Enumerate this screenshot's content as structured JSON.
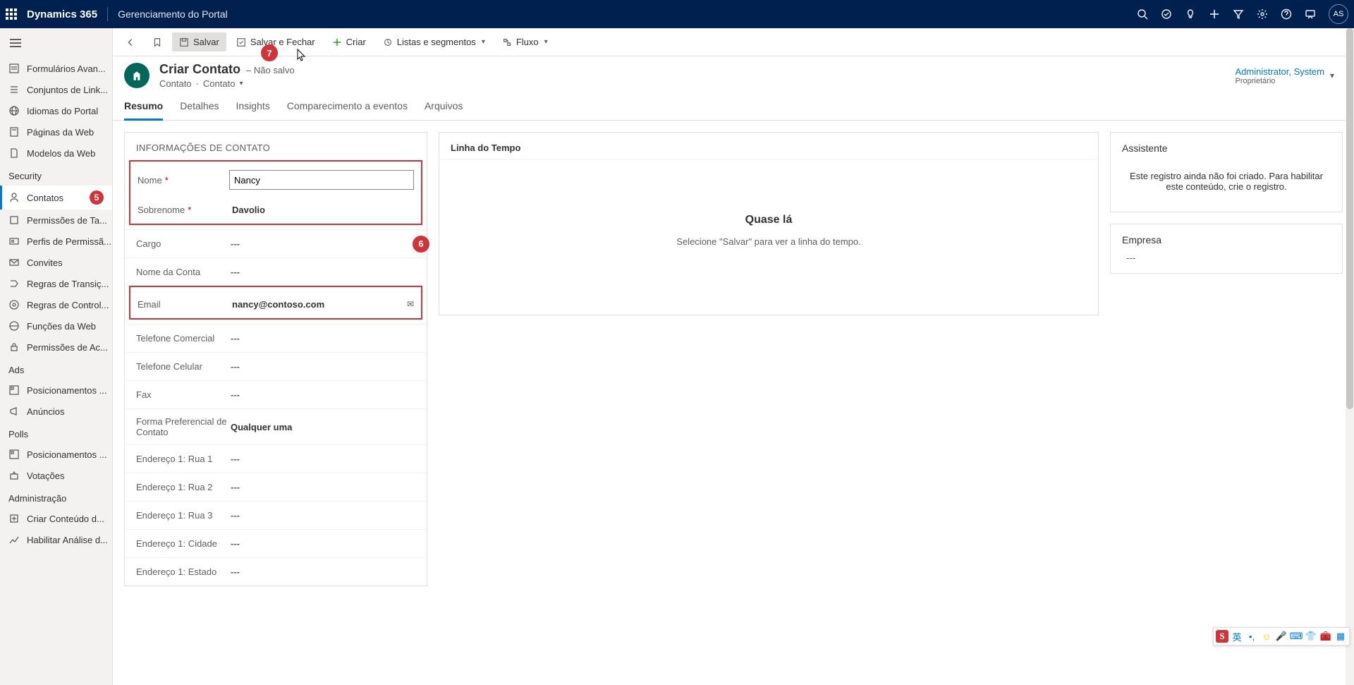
{
  "topbar": {
    "appName": "Dynamics 365",
    "subName": "Gerenciamento do Portal",
    "avatar": "AS"
  },
  "nav": {
    "topItems": [
      {
        "label": "Formulários Avan..."
      },
      {
        "label": "Conjuntos de Link..."
      },
      {
        "label": "Idiomas do Portal"
      },
      {
        "label": "Páginas da Web"
      },
      {
        "label": "Modelos da Web"
      }
    ],
    "groups": [
      {
        "title": "Security",
        "items": [
          {
            "label": "Contatos",
            "active": true,
            "badge": "5"
          },
          {
            "label": "Permissões de Ta..."
          },
          {
            "label": "Perfis de Permissã..."
          },
          {
            "label": "Convites"
          },
          {
            "label": "Regras de Transiç..."
          },
          {
            "label": "Regras de Control..."
          },
          {
            "label": "Funções da Web"
          },
          {
            "label": "Permissões de Ac..."
          }
        ]
      },
      {
        "title": "Ads",
        "items": [
          {
            "label": "Posicionamentos ..."
          },
          {
            "label": "Anúncios"
          }
        ]
      },
      {
        "title": "Polls",
        "items": [
          {
            "label": "Posicionamentos ..."
          },
          {
            "label": "Votações"
          }
        ]
      },
      {
        "title": "Administração",
        "items": [
          {
            "label": "Criar Conteúdo d..."
          },
          {
            "label": "Habilitar Análise d..."
          }
        ]
      }
    ]
  },
  "cmd": {
    "save": "Salvar",
    "saveClose": "Salvar e Fechar",
    "create": "Criar",
    "lists": "Listas e segmentos",
    "flow": "Fluxo"
  },
  "annot": {
    "a5": "5",
    "a6": "6",
    "a7": "7"
  },
  "record": {
    "title": "Criar Contato",
    "unsaved": "– Não salvo",
    "crumb1": "Contato",
    "crumb2": "Contato",
    "ownerName": "Administrator, System",
    "ownerLabel": "Proprietário"
  },
  "tabs": [
    "Resumo",
    "Detalhes",
    "Insights",
    "Comparecimento a eventos",
    "Arquivos"
  ],
  "contactSection": {
    "heading": "INFORMAÇÕES DE CONTATO",
    "nameLabel": "Nome",
    "nameValue": "Nancy",
    "lastNameLabel": "Sobrenome",
    "lastNameValue": "Davolio",
    "jobLabel": "Cargo",
    "accountLabel": "Nome da Conta",
    "emailLabel": "Email",
    "emailValue": "nancy@contoso.com",
    "bphoneLabel": "Telefone Comercial",
    "mphoneLabel": "Telefone Celular",
    "faxLabel": "Fax",
    "prefLabel": "Forma Preferencial de Contato",
    "prefValue": "Qualquer uma",
    "a1s1": "Endereço 1: Rua 1",
    "a1s2": "Endereço 1: Rua 2",
    "a1s3": "Endereço 1: Rua 3",
    "a1city": "Endereço 1: Cidade",
    "a1state": "Endereço 1: Estado",
    "dash": "---"
  },
  "timeline": {
    "header": "Linha do Tempo",
    "title": "Quase lá",
    "sub": "Selecione \"Salvar\" para ver a linha do tempo."
  },
  "assistant": {
    "header": "Assistente",
    "msg": "Este registro ainda não foi criado. Para habilitar este conteúdo, crie o registro."
  },
  "company": {
    "header": "Empresa",
    "val": "---"
  },
  "floatbar": {
    "lang": "英"
  }
}
